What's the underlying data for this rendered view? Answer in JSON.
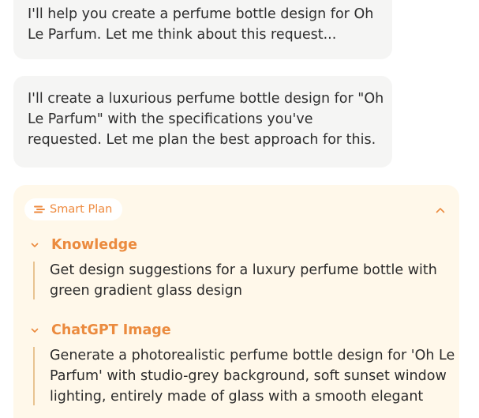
{
  "messages": [
    {
      "lines": [
        "I'll help you create a perfume bottle design for Oh",
        "Le Parfum. Let me think about this request..."
      ]
    },
    {
      "lines": [
        "I'll create a luxurious perfume bottle design for \"Oh",
        "Le Parfum\" with the specifications you've",
        "requested. Let me plan the best approach for this."
      ]
    }
  ],
  "plan": {
    "badge_label": "Smart Plan",
    "badge_icon": "plan-list-icon",
    "collapse_icon": "chevron-up-icon",
    "accent_color": "#eb8b3f",
    "background_color": "#fff8ea",
    "steps": [
      {
        "title": "Knowledge",
        "icon": "chevron-down-icon",
        "lines": [
          "Get design suggestions for a luxury perfume bottle with",
          "green gradient glass design"
        ]
      },
      {
        "title": "ChatGPT Image",
        "icon": "chevron-down-icon",
        "lines": [
          "Generate a photorealistic perfume bottle design for 'Oh Le",
          "Parfum' with studio-grey background, soft sunset window",
          "lighting, entirely made of glass with a smooth elegant"
        ]
      }
    ]
  }
}
